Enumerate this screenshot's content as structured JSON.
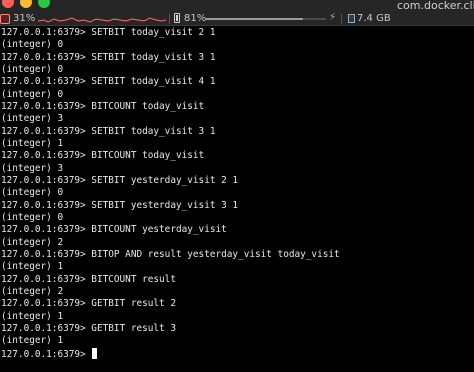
{
  "status_bar": {
    "cpu": "31%",
    "battery": "81%",
    "battery_level": 0.81,
    "memory": "7.4 GB",
    "window_title": "com.docker.cli"
  },
  "colors": {
    "background": "#000000",
    "text": "#e8e8e8",
    "cpu_graph": "#ff6b6b"
  },
  "terminal": {
    "lines": [
      "127.0.0.1:6379> SETBIT today_visit 2 1",
      "(integer) 0",
      "127.0.0.1:6379> SETBIT today_visit 3 1",
      "(integer) 0",
      "127.0.0.1:6379> SETBIT today_visit 4 1",
      "(integer) 0",
      "127.0.0.1:6379> BITCOUNT today_visit",
      "(integer) 3",
      "127.0.0.1:6379> SETBIT today_visit 3 1",
      "(integer) 1",
      "127.0.0.1:6379> BITCOUNT today_visit",
      "(integer) 3",
      "127.0.0.1:6379> SETBIT yesterday_visit 2 1",
      "(integer) 0",
      "127.0.0.1:6379> SETBIT yesterday_visit 3 1",
      "(integer) 0",
      "127.0.0.1:6379> BITCOUNT yesterday_visit",
      "(integer) 2",
      "127.0.0.1:6379> BITOP AND result yesterday_visit today_visit",
      "(integer) 1",
      "127.0.0.1:6379> BITCOUNT result",
      "(integer) 2",
      "127.0.0.1:6379> GETBIT result 2",
      "(integer) 1",
      "127.0.0.1:6379> GETBIT result 3",
      "(integer) 1"
    ],
    "prompt": "127.0.0.1:6379> "
  }
}
